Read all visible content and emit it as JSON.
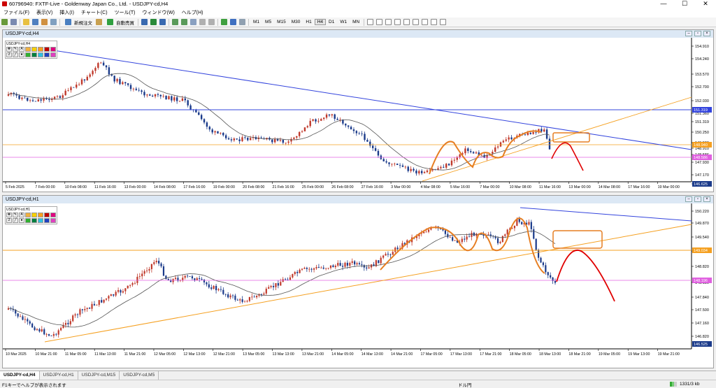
{
  "window": {
    "title": "60796940: FXTF-Live - Goldenway Japan Co., Ltd. - USDJPY-cd,H4",
    "min": "—",
    "max": "☐",
    "close": "✕"
  },
  "menu": [
    "ファイル(F)",
    "表示(V)",
    "挿入(I)",
    "チャート(C)",
    "ツール(T)",
    "ウィンドウ(W)",
    "ヘルプ(H)"
  ],
  "toolbar": {
    "new_order": "新規注文",
    "auto_trade": "自動売買",
    "timeframes": [
      "M1",
      "M5",
      "M15",
      "M30",
      "H1",
      "H4",
      "D1",
      "W1",
      "MN"
    ],
    "active_timeframe": "H4"
  },
  "colors": {
    "bull": "#c0392b",
    "bear": "#1a3a8a",
    "ma": "#555555",
    "trend_blue": "#3344dd",
    "trend_orange": "#f5a020",
    "swing": "#e67e22",
    "forecast": "#e00000",
    "pink": "#e060e0"
  },
  "chart_top": {
    "window_title": "USDJPY-cd,H4",
    "inner_label": "USDJPY-cd,H4",
    "prices": [
      "154.910",
      "154.240",
      "153.570",
      "152.700",
      "152.030",
      "151.360",
      "151.319",
      "150.250",
      "149.580",
      "148.910",
      "148.586",
      "147.930",
      "147.170",
      "146.625"
    ],
    "marked_prices": {
      "blue": "151.319",
      "orange": "148.940",
      "pink": "148.586",
      "last": "146.625"
    },
    "times": [
      "5 Feb 2025",
      "7 Feb 00:00",
      "10 Feb 08:00",
      "11 Feb 16:00",
      "13 Feb 00:00",
      "14 Feb 08:00",
      "17 Feb 16:00",
      "19 Feb 00:00",
      "20 Feb 08:00",
      "21 Feb 16:00",
      "25 Feb 00:00",
      "26 Feb 08:00",
      "27 Feb 16:00",
      "3 Mar 00:00",
      "4 Mar 08:00",
      "5 Mar 16:00",
      "7 Mar 00:00",
      "10 Mar 08:00",
      "11 Mar 16:00",
      "13 Mar 00:00",
      "14 Mar 08:00",
      "17 Mar 16:00",
      "19 Mar 00:00"
    ]
  },
  "chart_bottom": {
    "window_title": "USDJPY-cd,H1",
    "inner_label": "USDJPY-cd,H1",
    "prices": [
      "150.220",
      "149.870",
      "149.540",
      "149.210",
      "148.820",
      "148.180",
      "147.840",
      "147.500",
      "147.160",
      "146.820"
    ],
    "marked_prices": {
      "orange": "149.034",
      "pink": "148.196",
      "last": "146.525"
    },
    "times": [
      "10 Mar 2025",
      "10 Mar 21:00",
      "11 Mar 05:00",
      "11 Mar 13:00",
      "11 Mar 21:00",
      "12 Mar 05:00",
      "12 Mar 13:00",
      "12 Mar 21:00",
      "13 Mar 05:00",
      "13 Mar 13:00",
      "13 Mar 21:00",
      "14 Mar 05:00",
      "14 Mar 13:00",
      "14 Mar 21:00",
      "17 Mar 05:00",
      "17 Mar 13:00",
      "17 Mar 21:00",
      "18 Mar 05:00",
      "18 Mar 13:00",
      "18 Mar 21:00",
      "19 Mar 05:00",
      "19 Mar 13:00",
      "19 Mar 21:00"
    ]
  },
  "tabs": [
    "USDJPY-cd,H4",
    "USDJPY-cd,H1",
    "USDJPY-cd,M15",
    "USDJPY-cd,M5"
  ],
  "active_tab": "USDJPY-cd,H4",
  "status": {
    "help": "F1キーでヘルプが表示されます",
    "profile": "ドル円",
    "traffic": "1331/3 kb"
  }
}
